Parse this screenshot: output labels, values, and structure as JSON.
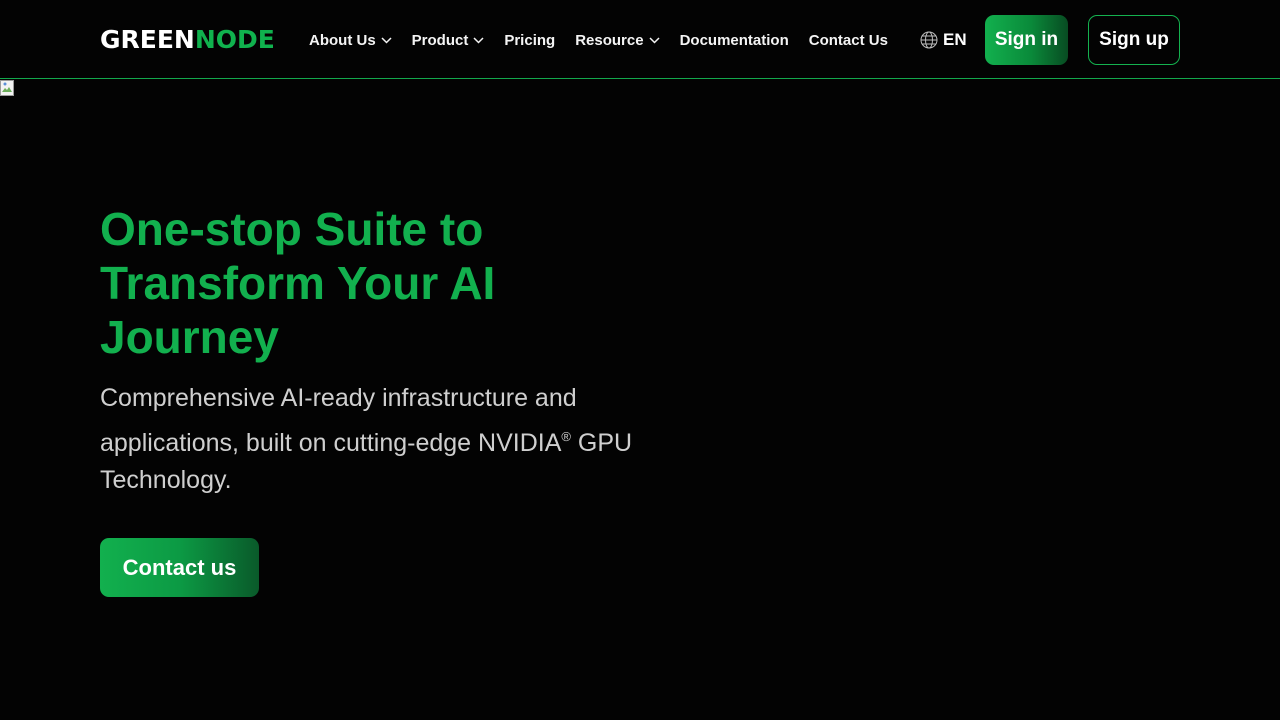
{
  "header": {
    "logo": {
      "part1": "GREEN",
      "part2": "NODE"
    },
    "nav": [
      {
        "label": "About Us",
        "dropdown": true
      },
      {
        "label": "Product",
        "dropdown": true
      },
      {
        "label": "Pricing",
        "dropdown": false
      },
      {
        "label": "Resource",
        "dropdown": true
      },
      {
        "label": "Documentation",
        "dropdown": false
      },
      {
        "label": "Contact Us",
        "dropdown": false
      }
    ],
    "language": "EN",
    "sign_in": "Sign in",
    "sign_up": "Sign up"
  },
  "hero": {
    "title": "One-stop Suite to Transform Your AI Journey",
    "subtitle_main": "Comprehensive AI-ready infrastructure and applications, built on cutting-edge NVIDIA",
    "subtitle_mark": "®",
    "subtitle_end": " GPU Technology.",
    "cta": "Contact us"
  },
  "colors": {
    "accent": "#12b04e",
    "background": "#030303",
    "text": "#ffffff",
    "muted_text": "#cfcfcf"
  },
  "icons": {
    "dropdown": "chevron-down-icon",
    "language": "globe-icon",
    "hero_image": "broken-image-icon"
  }
}
